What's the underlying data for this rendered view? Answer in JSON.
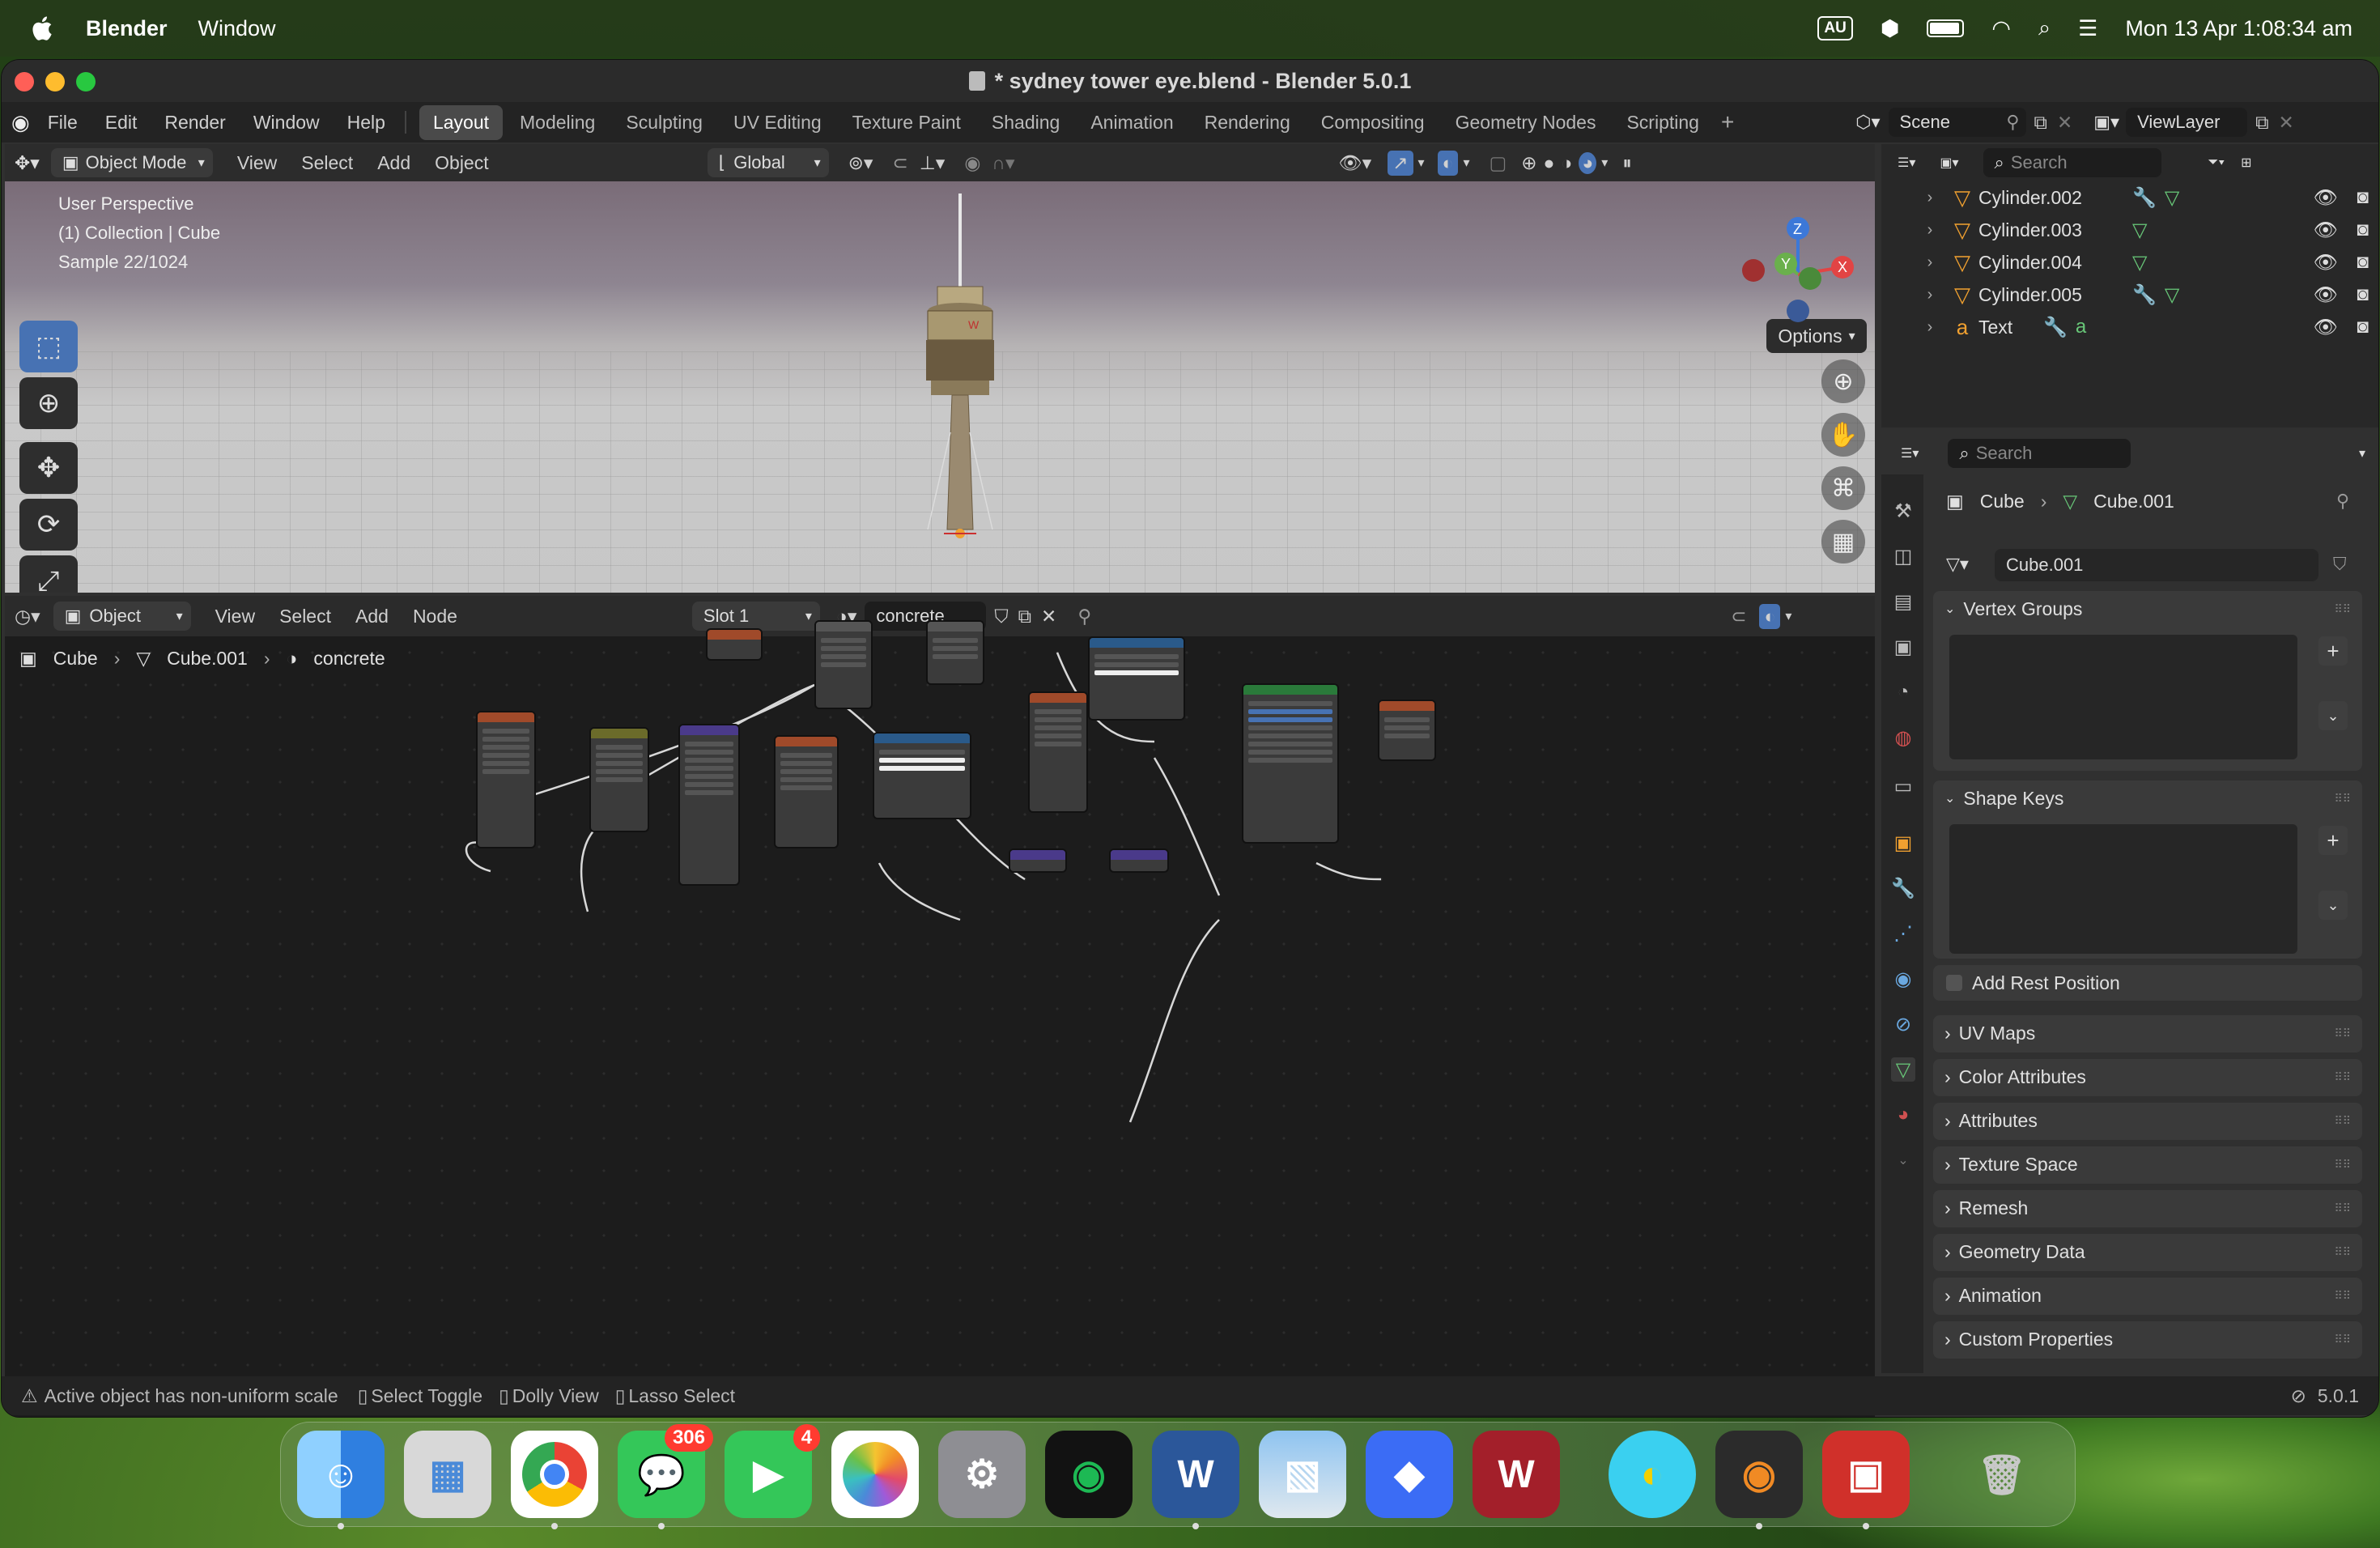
{
  "menubar": {
    "app": "Blender",
    "items": [
      "Window"
    ],
    "clock": "Mon 13 Apr  1:08:34 am",
    "input_source": "AU"
  },
  "window": {
    "title": "* sydney tower eye.blend - Blender 5.0.1"
  },
  "topbar": {
    "menus": [
      "File",
      "Edit",
      "Render",
      "Window",
      "Help"
    ],
    "workspaces": [
      "Layout",
      "Modeling",
      "Sculpting",
      "UV Editing",
      "Texture Paint",
      "Shading",
      "Animation",
      "Rendering",
      "Compositing",
      "Geometry Nodes",
      "Scripting"
    ],
    "active_workspace": "Layout",
    "scene": "Scene",
    "view_layer": "ViewLayer"
  },
  "viewport": {
    "mode": "Object Mode",
    "menus": [
      "View",
      "Select",
      "Add",
      "Object"
    ],
    "orientation": "Global",
    "options_label": "Options",
    "hud": [
      "User Perspective",
      "(1) Collection | Cube",
      "Sample 22/1024"
    ],
    "gizmo": {
      "z": "Z",
      "y": "Y",
      "x": "X"
    }
  },
  "outliner": {
    "search_placeholder": "Search",
    "rows": [
      {
        "name": "Cylinder.002",
        "icon": "mesh-object-icon",
        "modifier": true
      },
      {
        "name": "Cylinder.003",
        "icon": "mesh-object-icon",
        "modifier": false
      },
      {
        "name": "Cylinder.004",
        "icon": "mesh-object-icon",
        "modifier": false
      },
      {
        "name": "Cylinder.005",
        "icon": "mesh-object-icon",
        "modifier": true
      },
      {
        "name": "Text",
        "icon": "text-object-icon",
        "modifier": true
      }
    ]
  },
  "properties": {
    "search_placeholder": "Search",
    "breadcrumb": [
      "Cube",
      "Cube.001"
    ],
    "mesh_name": "Cube.001",
    "panels_open": [
      "Vertex Groups",
      "Shape Keys"
    ],
    "add_rest_position": "Add Rest Position",
    "panels_closed": [
      "UV Maps",
      "Color Attributes",
      "Attributes",
      "Texture Space",
      "Remesh",
      "Geometry Data",
      "Animation",
      "Custom Properties"
    ]
  },
  "node_editor": {
    "editor_type": "Object",
    "menus": [
      "View",
      "Select",
      "Add",
      "Node"
    ],
    "slot": "Slot 1",
    "material": "concrete",
    "breadcrumb": [
      "Cube",
      "Cube.001",
      "concrete"
    ]
  },
  "statusbar": {
    "items": [
      "Active object has non-uniform scale",
      "Select Toggle",
      "Dolly View",
      "Lasso Select"
    ],
    "version": "5.0.1"
  },
  "dock": {
    "apps": [
      {
        "name": "Finder",
        "icon": "finder-icon",
        "color": "#3a8ee6"
      },
      {
        "name": "Launchpad",
        "icon": "launchpad-icon",
        "color": "#d0d0d0"
      },
      {
        "name": "Chrome",
        "icon": "chrome-icon",
        "color": "#ffffff"
      },
      {
        "name": "Messages",
        "icon": "messages-icon",
        "color": "#34c759",
        "badge": "306"
      },
      {
        "name": "FaceTime",
        "icon": "facetime-icon",
        "color": "#34c759",
        "badge": "4"
      },
      {
        "name": "Photos",
        "icon": "photos-icon",
        "color": "#ffffff"
      },
      {
        "name": "System Settings",
        "icon": "settings-icon",
        "color": "#8e8e93"
      },
      {
        "name": "Spotify",
        "icon": "spotify-icon",
        "color": "#121212"
      },
      {
        "name": "Word",
        "icon": "word-icon",
        "color": "#2b579a"
      },
      {
        "name": "Preview",
        "icon": "preview-icon",
        "color": "#5aa0d8"
      },
      {
        "name": "Roblox Studio",
        "icon": "roblox-icon",
        "color": "#3b6cf5"
      },
      {
        "name": "WPS",
        "icon": "wps-icon",
        "color": "#a31f2a"
      },
      {
        "name": "Folder Colorizer",
        "icon": "macos-folder-icon",
        "color": "#3ad0f0"
      },
      {
        "name": "Blender",
        "icon": "blender-icon",
        "color": "#2b2b2b"
      },
      {
        "name": "Photo Booth",
        "icon": "photobooth-icon",
        "color": "#d0302a"
      },
      {
        "name": "Trash",
        "icon": "trash-icon",
        "color": "#b8b8b8"
      }
    ]
  }
}
